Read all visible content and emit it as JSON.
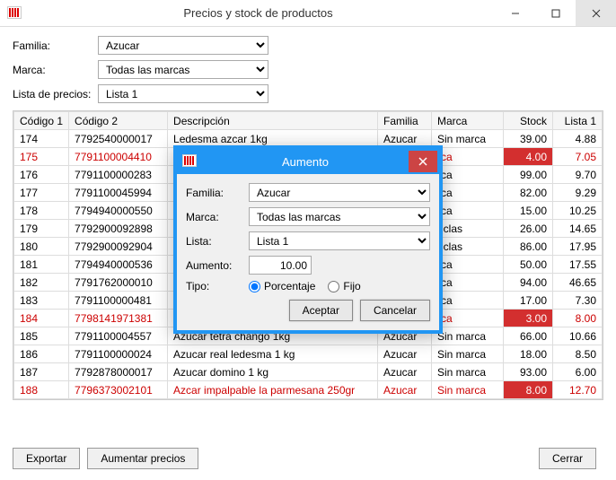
{
  "window": {
    "title": "Precios y stock de productos",
    "dialog_title": "Aumento"
  },
  "filters": {
    "familia_label": "Familia:",
    "familia_value": "Azucar",
    "marca_label": "Marca:",
    "marca_value": "Todas las marcas",
    "lista_label": "Lista de precios:",
    "lista_value": "Lista 1"
  },
  "columns": {
    "c1": "Código 1",
    "c2": "Código 2",
    "desc": "Descripción",
    "fam": "Familia",
    "marca": "Marca",
    "stock": "Stock",
    "lista": "Lista 1"
  },
  "rows": [
    {
      "c1": "174",
      "c2": "7792540000017",
      "desc": "Ledesma azcar 1kg",
      "fam": "Azucar",
      "marca": "Sin marca",
      "stock": "39.00",
      "lista": "4.88",
      "red": false,
      "lowstock": false
    },
    {
      "c1": "175",
      "c2": "7791100004410",
      "desc": "",
      "fam": "",
      "marca": "rca",
      "stock": "4.00",
      "lista": "7.05",
      "red": true,
      "lowstock": true
    },
    {
      "c1": "176",
      "c2": "7791100000283",
      "desc": "",
      "fam": "",
      "marca": "rca",
      "stock": "99.00",
      "lista": "9.70",
      "red": false,
      "lowstock": false
    },
    {
      "c1": "177",
      "c2": "7791100045994",
      "desc": "",
      "fam": "",
      "marca": "rca",
      "stock": "82.00",
      "lista": "9.29",
      "red": false,
      "lowstock": false
    },
    {
      "c1": "178",
      "c2": "7794940000550",
      "desc": "",
      "fam": "",
      "marca": "rca",
      "stock": "15.00",
      "lista": "10.25",
      "red": false,
      "lowstock": false
    },
    {
      "c1": "179",
      "c2": "7792900092898",
      "desc": "",
      "fam": "",
      "marca": "uclas",
      "stock": "26.00",
      "lista": "14.65",
      "red": false,
      "lowstock": false
    },
    {
      "c1": "180",
      "c2": "7792900092904",
      "desc": "",
      "fam": "",
      "marca": "uclas",
      "stock": "86.00",
      "lista": "17.95",
      "red": false,
      "lowstock": false
    },
    {
      "c1": "181",
      "c2": "7794940000536",
      "desc": "",
      "fam": "",
      "marca": "rca",
      "stock": "50.00",
      "lista": "17.55",
      "red": false,
      "lowstock": false
    },
    {
      "c1": "182",
      "c2": "7791762000010",
      "desc": "",
      "fam": "",
      "marca": "rca",
      "stock": "94.00",
      "lista": "46.65",
      "red": false,
      "lowstock": false
    },
    {
      "c1": "183",
      "c2": "7791100000481",
      "desc": "",
      "fam": "",
      "marca": "rca",
      "stock": "17.00",
      "lista": "7.30",
      "red": false,
      "lowstock": false
    },
    {
      "c1": "184",
      "c2": "7798141971381",
      "desc": "",
      "fam": "",
      "marca": "rca",
      "stock": "3.00",
      "lista": "8.00",
      "red": true,
      "lowstock": true
    },
    {
      "c1": "185",
      "c2": "7791100004557",
      "desc": "Azucar tetra chango 1kg",
      "fam": "Azucar",
      "marca": "Sin marca",
      "stock": "66.00",
      "lista": "10.66",
      "red": false,
      "lowstock": false
    },
    {
      "c1": "186",
      "c2": "7791100000024",
      "desc": "Azucar real ledesma 1 kg",
      "fam": "Azucar",
      "marca": "Sin marca",
      "stock": "18.00",
      "lista": "8.50",
      "red": false,
      "lowstock": false
    },
    {
      "c1": "187",
      "c2": "7792878000017",
      "desc": "Azucar domino 1 kg",
      "fam": "Azucar",
      "marca": "Sin marca",
      "stock": "93.00",
      "lista": "6.00",
      "red": false,
      "lowstock": false
    },
    {
      "c1": "188",
      "c2": "7796373002101",
      "desc": "Azcar impalpable la parmesana 250gr",
      "fam": "Azucar",
      "marca": "Sin marca",
      "stock": "8.00",
      "lista": "12.70",
      "red": true,
      "lowstock": true
    }
  ],
  "buttons": {
    "exportar": "Exportar",
    "aumentar": "Aumentar precios",
    "cerrar": "Cerrar"
  },
  "dialog": {
    "familia_label": "Familia:",
    "familia_value": "Azucar",
    "marca_label": "Marca:",
    "marca_value": "Todas las marcas",
    "lista_label": "Lista:",
    "lista_value": "Lista 1",
    "aumento_label": "Aumento:",
    "aumento_value": "10.00",
    "tipo_label": "Tipo:",
    "radio_porcentaje": "Porcentaje",
    "radio_fijo": "Fijo",
    "aceptar": "Aceptar",
    "cancelar": "Cancelar"
  }
}
